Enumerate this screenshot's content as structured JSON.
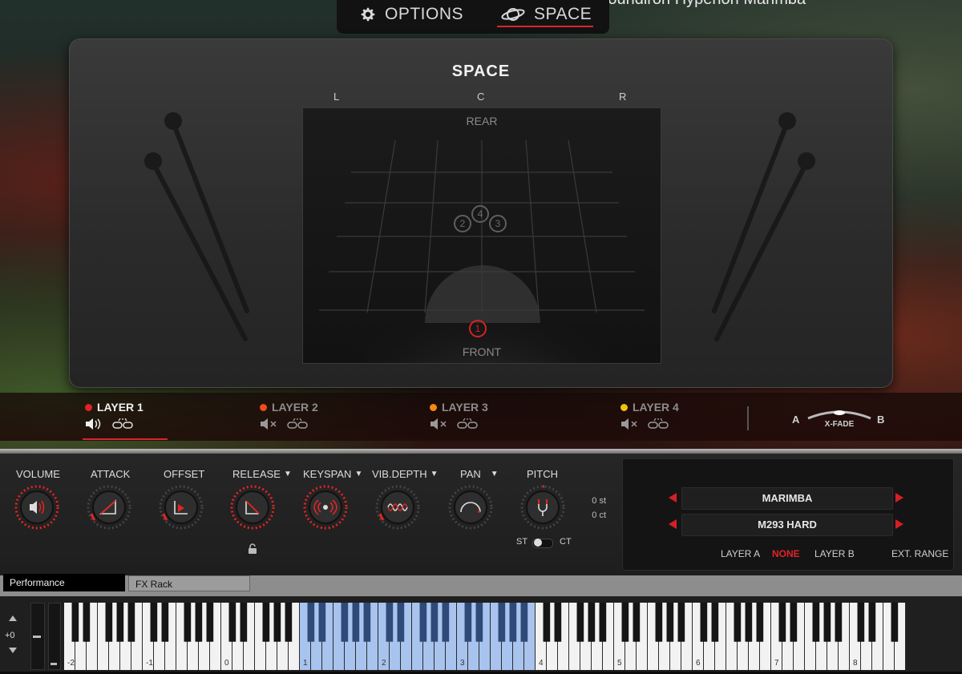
{
  "window_title": "Soundiron Hyperion Marimba",
  "top_tabs": {
    "options": "OPTIONS",
    "space": "SPACE"
  },
  "space": {
    "title": "SPACE",
    "axis": {
      "left": "L",
      "center": "C",
      "right": "R"
    },
    "rear_label": "REAR",
    "front_label": "FRONT",
    "nodes": [
      "1",
      "2",
      "3",
      "4"
    ]
  },
  "layers": [
    {
      "name": "LAYER 1",
      "color": "#e02424"
    },
    {
      "name": "LAYER 2",
      "color": "#ef4b1c"
    },
    {
      "name": "LAYER 3",
      "color": "#f28a12"
    },
    {
      "name": "LAYER 4",
      "color": "#f0c20e"
    }
  ],
  "xfade": {
    "a": "A",
    "b": "B",
    "label": "X-FADE"
  },
  "knobs": {
    "volume": "VOLUME",
    "attack": "ATTACK",
    "offset": "OFFSET",
    "release": "RELEASE",
    "keyspan": "KEYSPAN",
    "vibdepth": "VIB.DEPTH",
    "pan": "PAN",
    "pitch": "PITCH"
  },
  "pitch": {
    "st_value": "0 st",
    "ct_value": "0 ct",
    "st_label": "ST",
    "ct_label": "CT"
  },
  "preset": {
    "instrument": "MARIMBA",
    "mallet": "M293 HARD"
  },
  "layer_select": {
    "a": "LAYER A",
    "none": "NONE",
    "b": "LAYER B",
    "ext": "EXT. RANGE"
  },
  "bottom_tabs": {
    "performance": "Performance",
    "fx_rack": "FX Rack"
  },
  "keyboard": {
    "octave_shift": "+0",
    "octave_labels": [
      "-2",
      "-1",
      "0",
      "1",
      "2",
      "3",
      "4",
      "5",
      "6",
      "7",
      "8"
    ]
  },
  "colors": {
    "accent": "#d8262a",
    "key_range": "#a8c4ee"
  }
}
